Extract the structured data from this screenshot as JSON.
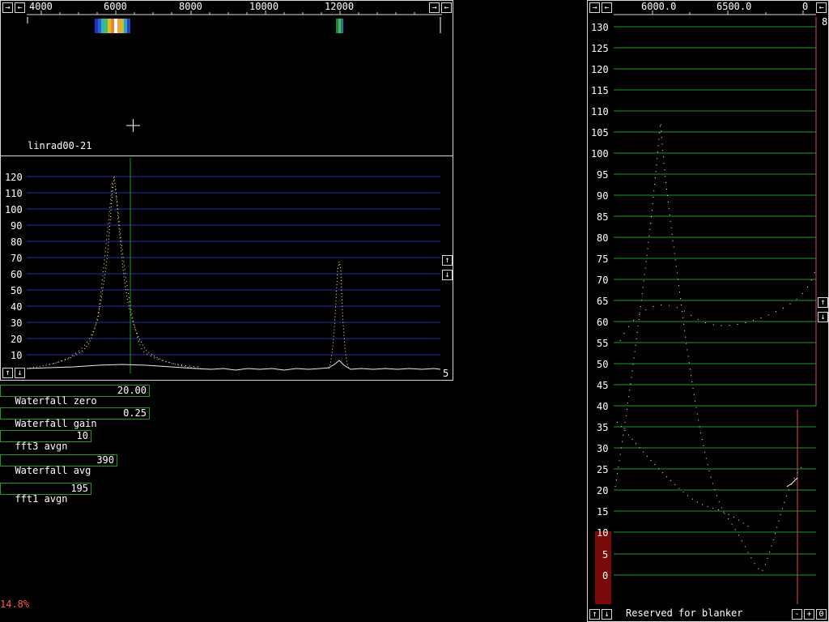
{
  "waterfall": {
    "freq_ticks": [
      "4000",
      "6000",
      "8000",
      "10000",
      "12000"
    ],
    "title": "linrad00-21"
  },
  "spectrum": {
    "y_ticks": [
      "120",
      "110",
      "100",
      "90",
      "80",
      "70",
      "60",
      "50",
      "40",
      "30",
      "20",
      "10"
    ],
    "corner_value": "5"
  },
  "params": [
    {
      "label": "Waterfall zero",
      "value": "20.00"
    },
    {
      "label": "Waterfall gain",
      "value": "0.25"
    },
    {
      "label": "fft3 avgn",
      "value": "10"
    },
    {
      "label": "Waterfall avg",
      "value": "390"
    },
    {
      "label": "fft1 avgn",
      "value": "195"
    }
  ],
  "status": {
    "cpu_load": "14.8%"
  },
  "baseband": {
    "freq_ticks": [
      "6000.0",
      "6500.0"
    ],
    "right_edge_label": "0",
    "corner_value": "8",
    "y_ticks": [
      "130",
      "125",
      "120",
      "115",
      "110",
      "105",
      "100",
      "95",
      "90",
      "85",
      "80",
      "75",
      "70",
      "65",
      "60",
      "55",
      "50",
      "45",
      "40",
      "35",
      "30",
      "25",
      "20",
      "15",
      "10",
      "5",
      "0"
    ],
    "blanker_text": "Reserved for blanker"
  },
  "icons": {
    "arrow_right": "→",
    "arrow_left": "←",
    "arrow_up": "↑",
    "arrow_down": "↓",
    "minus": "-",
    "plus": "+",
    "zero": "0"
  },
  "colors": {
    "grid_blue": "#1a2fa8",
    "grid_green": "#1f9a1f",
    "marker_red": "#d85050",
    "status_red": "#ff5555"
  }
}
